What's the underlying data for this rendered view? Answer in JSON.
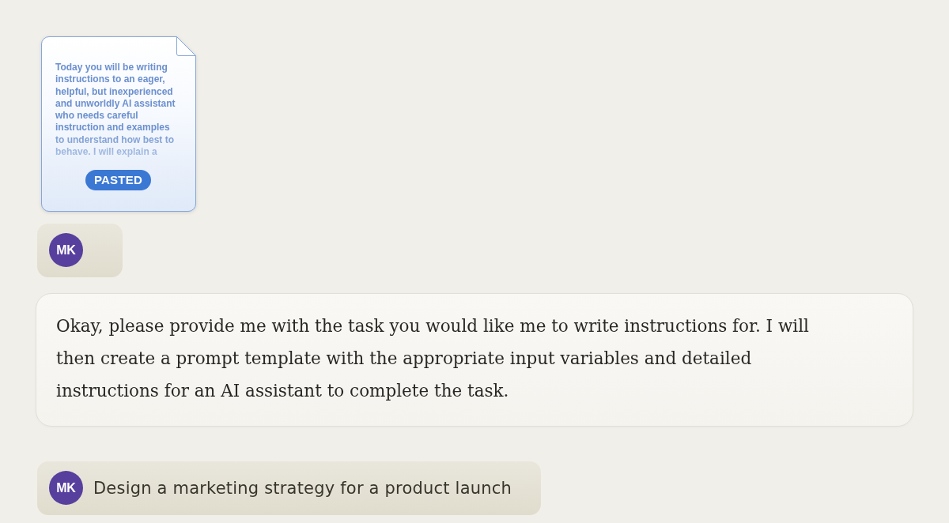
{
  "conversation": [
    {
      "kind": "pasted_document",
      "preview_text": "Today you will be writing instructions to an eager, helpful, but inexperienced and unworldly AI assistant who needs careful instruction and examples to understand how best to behave. I will explain a",
      "badge": "PASTED"
    },
    {
      "kind": "user_message",
      "avatar": "MK"
    },
    {
      "kind": "assistant_message",
      "text": "Okay, please provide me with the task you would like me to write instructions for. I will then create a prompt template with the appropriate input variables and detailed instructions for an AI assistant to complete the task."
    },
    {
      "kind": "user_message",
      "avatar": "MK",
      "text": "Design a marketing strategy for a product launch"
    }
  ]
}
